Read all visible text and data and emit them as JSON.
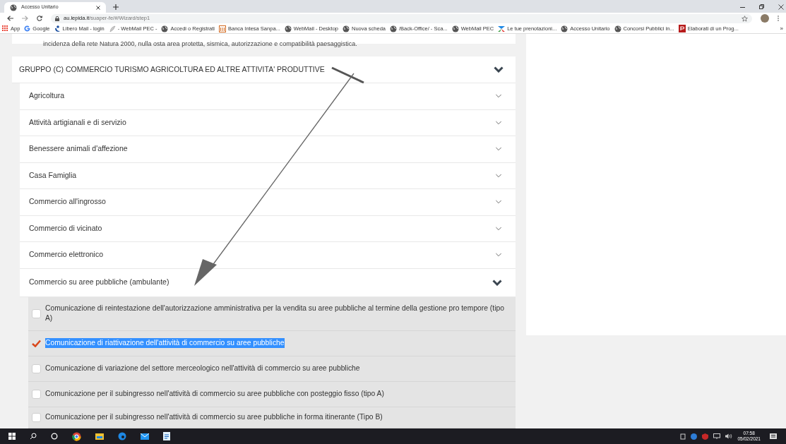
{
  "browser": {
    "tabs": [
      {
        "title": "Accesso Unitario",
        "selected": true
      }
    ],
    "url_host": "au.lepida.it",
    "url_path": "/suaper-fe/#/Wizard/step1",
    "bookmarks": [
      {
        "label": "App",
        "kind": "apps"
      },
      {
        "label": "Google",
        "kind": "google"
      },
      {
        "label": "Libero Mail - login",
        "kind": "libero"
      },
      {
        "label": "- WebMail PEC -",
        "kind": "feather"
      },
      {
        "label": "Accedi o Registrati",
        "kind": "globe"
      },
      {
        "label": "Banca Intesa Sanpa...",
        "kind": "bank"
      },
      {
        "label": "WebMail - Desktop",
        "kind": "globe"
      },
      {
        "label": "Nuova scheda",
        "kind": "globe"
      },
      {
        "label": "/Back-Office/ - Sca...",
        "kind": "globe"
      },
      {
        "label": "WebMail PEC",
        "kind": "globe"
      },
      {
        "label": "Le tue prenotazioni...",
        "kind": "colors"
      },
      {
        "label": "Accesso Unitario",
        "kind": "globe"
      },
      {
        "label": "Concorsi Pubblici in...",
        "kind": "globe"
      },
      {
        "label": "Elaborati di un Prog...",
        "kind": "pdf"
      }
    ],
    "more": "»"
  },
  "page": {
    "cut_text": "incidenza della rete Natura 2000, nulla osta area protetta, sismica, autorizzazione e compatibilità paesaggistica.",
    "group": {
      "title": "GRUPPO (C) COMMERCIO TURISMO AGRICOLTURA ED ALTRE ATTIVITA' PRODUTTIVE",
      "expanded": true
    },
    "sections": [
      {
        "title": "Agricoltura",
        "expanded": false
      },
      {
        "title": "Attività artigianali e di servizio",
        "expanded": false
      },
      {
        "title": "Benessere animali d'affezione",
        "expanded": false
      },
      {
        "title": "Casa Famiglia",
        "expanded": false
      },
      {
        "title": "Commercio all'ingrosso",
        "expanded": false
      },
      {
        "title": "Commercio di vicinato",
        "expanded": false
      },
      {
        "title": "Commercio elettronico",
        "expanded": false
      },
      {
        "title": "Commercio su aree pubbliche (ambulante)",
        "expanded": true
      }
    ],
    "options": [
      {
        "label": "Comunicazione di reintestazione dell'autorizzazione amministrativa per la vendita su aree pubbliche al termine della gestione pro tempore (tipo A)",
        "checked": false,
        "highlighted": false
      },
      {
        "label": "Comunicazione di riattivazione dell'attività di commercio su aree pubbliche",
        "checked": true,
        "highlighted": true
      },
      {
        "label": "Comunicazione di variazione del settore merceologico nell'attività di commercio su aree pubbliche",
        "checked": false,
        "highlighted": false
      },
      {
        "label": "Comunicazione per il subingresso nell'attività di commercio su aree pubbliche con posteggio fisso (tipo A)",
        "checked": false,
        "highlighted": false
      },
      {
        "label": "Comunicazione per il subingresso nell'attività di commercio su aree pubbliche in forma itinerante (Tipo B)",
        "checked": false,
        "highlighted": false
      }
    ]
  },
  "taskbar": {
    "time": "07:58",
    "date": "05/02/2021"
  }
}
